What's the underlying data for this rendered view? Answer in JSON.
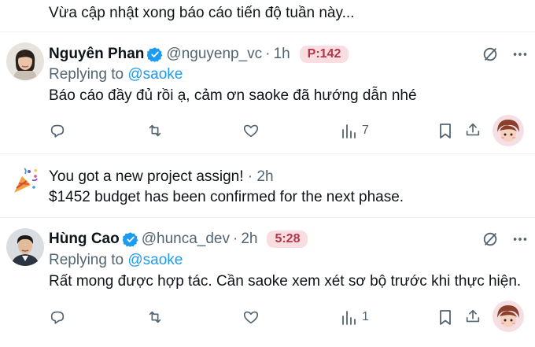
{
  "previous_post": {
    "text": "Vừa cập nhật xong báo cáo tiến độ tuần này..."
  },
  "tweets": [
    {
      "name": "Nguyên Phan",
      "handle": "@nguyenp_vc",
      "dot": "·",
      "time": "1h",
      "badge": "P:142",
      "replying_prefix": "Replying to ",
      "replying_to": "@saoke",
      "text": "Báo cáo đầy đủ rồi ạ, cảm ơn saoke đã hướng dẫn nhé",
      "views": "7",
      "icons": [
        "reply-icon",
        "retweet-icon",
        "like-icon",
        "views-icon",
        "bookmark-icon",
        "share-icon"
      ]
    },
    {
      "name": "Hùng Cao",
      "handle": "@hunca_dev",
      "dot": "·",
      "time": "2h",
      "badge": "5:28",
      "replying_prefix": "Replying to ",
      "replying_to": "@saoke",
      "text": "Rất mong được hợp tác. Cần saoke xem xét sơ bộ trước khi thực hiện.",
      "views": "1",
      "icons": [
        "reply-icon",
        "retweet-icon",
        "like-icon",
        "views-icon",
        "bookmark-icon",
        "share-icon"
      ]
    }
  ],
  "notification": {
    "icon": "party-popper-icon",
    "title": "You got a new project assign!",
    "dot": " · ",
    "time": "2h",
    "text": "$1452 budget has been confirmed for the next phase."
  },
  "colors": {
    "accent": "#1d9bf0",
    "muted": "#536471",
    "badge_bg": "#f9dde0",
    "badge_text": "#b3354a",
    "divider": "#eff3f4"
  }
}
